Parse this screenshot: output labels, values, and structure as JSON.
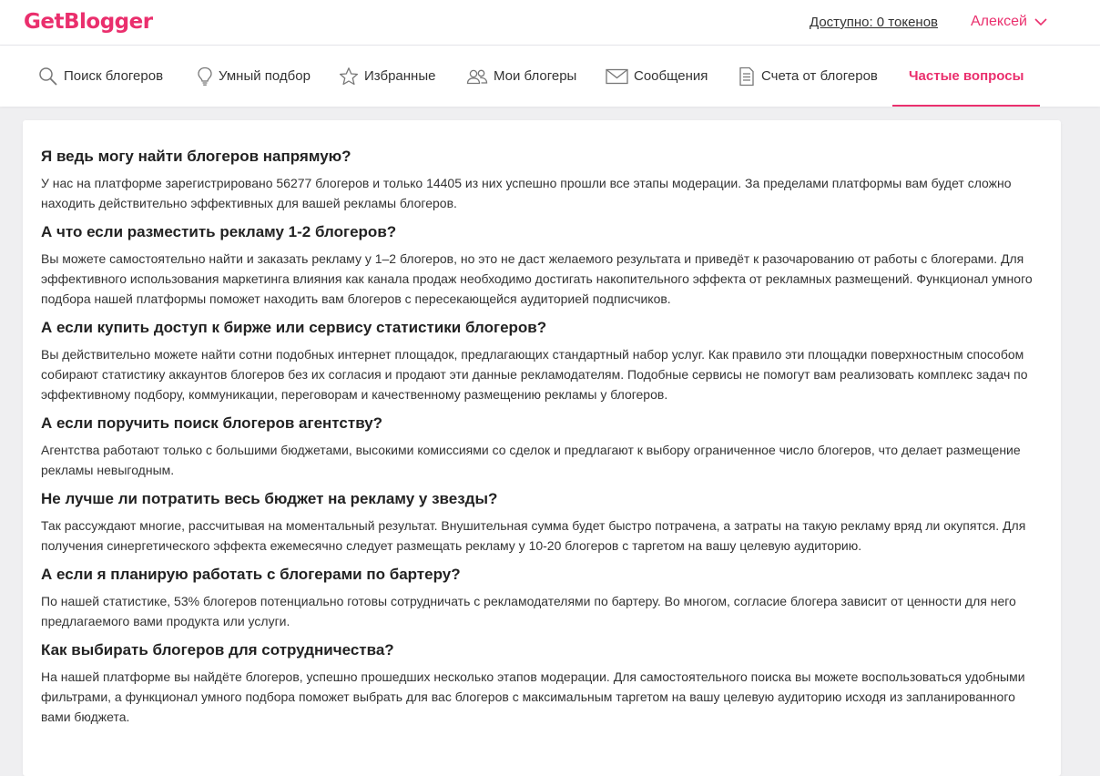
{
  "header": {
    "logo": "GetBlogger",
    "balance": "Доступно: 0 токенов",
    "user": "Алексей"
  },
  "nav": {
    "items": [
      {
        "label": "Поиск блогеров",
        "icon": "search-icon"
      },
      {
        "label": "Умный подбор",
        "icon": "lightbulb-icon"
      },
      {
        "label": "Избранные",
        "icon": "star-icon"
      },
      {
        "label": "Мои блогеры",
        "icon": "users-icon"
      },
      {
        "label": "Сообщения",
        "icon": "envelope-icon"
      },
      {
        "label": "Счета от блогеров",
        "icon": "invoice-icon"
      },
      {
        "label": "Частые вопросы",
        "icon": ""
      }
    ],
    "active": "Частые вопросы",
    "accent_color": "#ea2f6d"
  },
  "faq": [
    {
      "q": "Я ведь могу найти блогеров напрямую?",
      "a": "У нас на платформе зарегистрировано 56277 блогеров и только 14405 из них успешно прошли все этапы модерации. За пределами платформы вам будет сложно находить действительно эффективных для вашей рекламы блогеров."
    },
    {
      "q": "А что если разместить рекламу 1-2 блогеров?",
      "a": "Вы можете самостоятельно найти и заказать рекламу у 1–2 блогеров, но это не даст желаемого результата и приведёт к разочарованию от работы с блогерами. Для эффективного использования маркетинга влияния как канала продаж необходимо достигать накопительного эффекта от рекламных размещений. Функционал умного подбора нашей платформы поможет находить вам блогеров с пересекающейся аудиторией подписчиков."
    },
    {
      "q": "А если купить доступ к бирже или сервису статистики блогеров?",
      "a": "Вы действительно можете найти сотни подобных интернет площадок, предлагающих стандартный набор услуг. Как правило эти площадки поверхностным способом собирают статистику аккаунтов блогеров без их согласия и продают эти данные рекламодателям. Подобные сервисы не помогут вам реализовать комплекс задач по эффективному подбору, коммуникации, переговорам и качественному размещению рекламы у блогеров."
    },
    {
      "q": "А если поручить поиск блогеров агентству?",
      "a": "Агентства работают только с большими бюджетами, высокими комиссиями со сделок и предлагают к выбору ограниченное число блогеров, что делает размещение рекламы невыгодным."
    },
    {
      "q": "Не лучше ли потратить весь бюджет на рекламу у звезды?",
      "a": "Так рассуждают многие, рассчитывая на моментальный результат. Внушительная сумма будет быстро потрачена, а затраты на такую рекламу вряд ли окупятся. Для получения синергетического эффекта ежемесячно следует размещать рекламу у 10-20 блогеров с таргетом на вашу целевую аудиторию."
    },
    {
      "q": "А если я планирую работать с блогерами по бартеру?",
      "a": "По нашей статистике, 53% блогеров потенциально готовы сотрудничать с рекламодателями по бартеру. Во многом, согласие блогера зависит от ценности для него предлагаемого вами продукта или услуги."
    },
    {
      "q": "Как выбирать блогеров для сотрудничества?",
      "a": "На нашей платформе вы найдёте блогеров, успешно прошедших несколько этапов модерации. Для самостоятельного поиска вы можете воспользоваться удобными фильтрами, а функционал умного подбора поможет выбрать для вас блогеров с максимальным таргетом на вашу целевую аудиторию исходя из запланированного вами бюджета."
    }
  ]
}
